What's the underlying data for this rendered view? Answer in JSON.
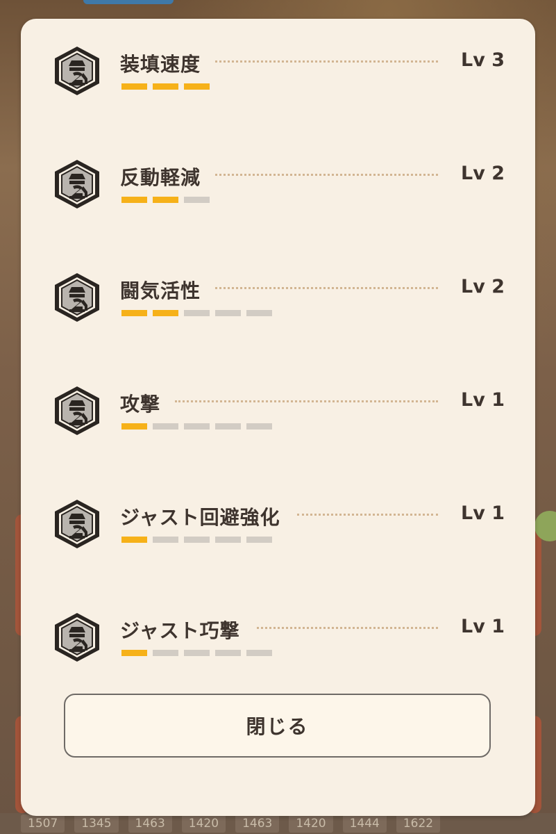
{
  "background": {
    "stats": [
      "1507",
      "1345",
      "1463",
      "1420",
      "1463",
      "1420",
      "1444",
      "1622"
    ]
  },
  "colors": {
    "pip_on": "#f6b119",
    "pip_off": "#d2ccc4",
    "panel": "#f8f0e4",
    "text": "#3e342e"
  },
  "skills": [
    {
      "name": "装填速度",
      "level": "Lv 3",
      "icon": "mechanical-arm-badge-icon",
      "filled": 3,
      "total": 3
    },
    {
      "name": "反動軽減",
      "level": "Lv 2",
      "icon": "mechanical-arm-badge-icon",
      "filled": 2,
      "total": 3
    },
    {
      "name": "闘気活性",
      "level": "Lv 2",
      "icon": "mechanical-arm-badge-icon",
      "filled": 2,
      "total": 5
    },
    {
      "name": "攻撃",
      "level": "Lv 1",
      "icon": "mechanical-arm-badge-icon",
      "filled": 1,
      "total": 5
    },
    {
      "name": "ジャスト回避強化",
      "level": "Lv 1",
      "icon": "mechanical-arm-badge-icon",
      "filled": 1,
      "total": 5
    },
    {
      "name": "ジャスト巧撃",
      "level": "Lv 1",
      "icon": "mechanical-arm-badge-icon",
      "filled": 1,
      "total": 5
    }
  ],
  "close_label": "閉じる"
}
